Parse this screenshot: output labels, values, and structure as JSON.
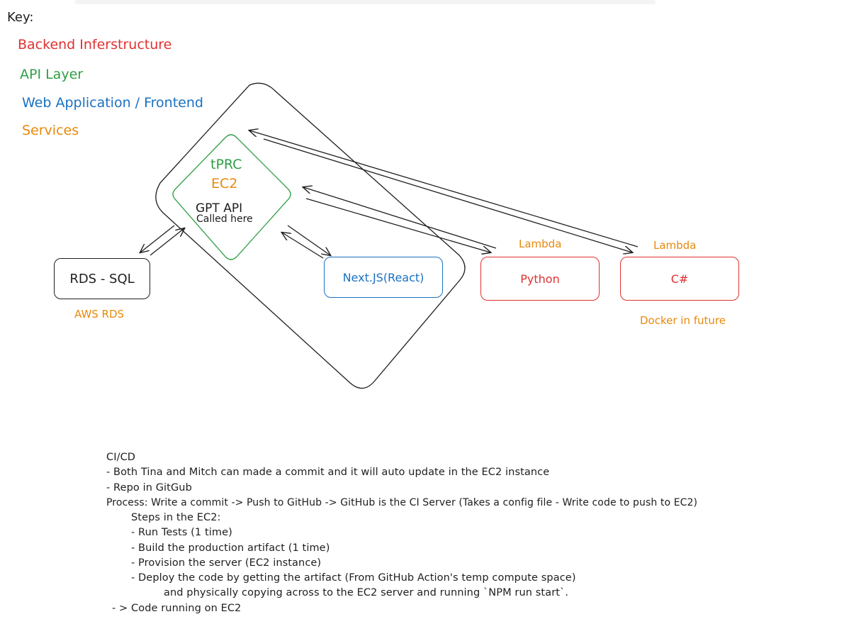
{
  "key": {
    "title": "Key:",
    "items": [
      {
        "label": "Backend Inferstructure",
        "color": "#e03131"
      },
      {
        "label": "API Layer",
        "color": "#2f9e44"
      },
      {
        "label": "Web Application / Frontend",
        "color": "#1971c2"
      },
      {
        "label": "Services",
        "color": "#e8890b"
      }
    ]
  },
  "nodes": {
    "trpc_label": "tPRC",
    "ec2_label": "EC2",
    "gpt_label": "GPT API",
    "called_label": "Called here",
    "rds_label": "RDS - SQL",
    "aws_rds_label": "AWS RDS",
    "nextjs_label": "Next.JS(React)",
    "python_label": "Python",
    "csharp_label": "C#",
    "lambda_python_label": "Lambda",
    "lambda_csharp_label": "Lambda",
    "docker_label": "Docker in future"
  },
  "colors": {
    "backend": "#e03131",
    "api": "#2f9e44",
    "frontend": "#1971c2",
    "services": "#e8890b",
    "ink": "#1e1e1e"
  },
  "cicd": {
    "lines": [
      "CI/CD",
      "- Both Tina and Mitch can made a commit and it will auto update in the EC2 instance",
      "- Repo in GitGub",
      "Process: Write a commit -> Push to GitHub -> GitHub is the CI Server (Takes a config file - Write code to push to EC2)",
      "Steps in the EC2:",
      "- Run Tests (1 time)",
      "- Build the production artifact (1 time)",
      "- Provision the server (EC2 instance)",
      "- Deploy the code by getting the artifact (From GitHub Action's temp compute space)",
      "and physically copying across to the EC2 server and running `NPM run start`.",
      "- > Code running on EC2"
    ]
  }
}
